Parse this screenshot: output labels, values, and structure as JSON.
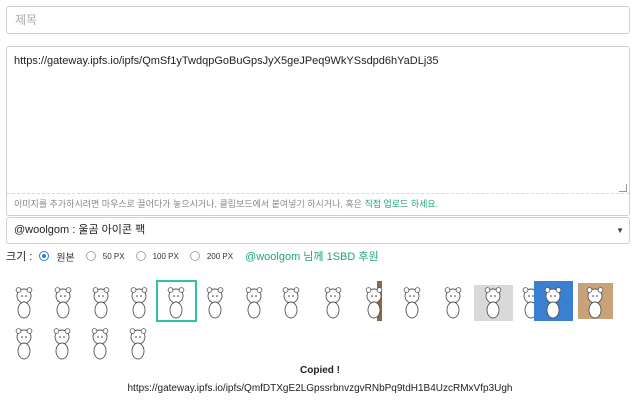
{
  "title_input": {
    "placeholder": "제목"
  },
  "editor": {
    "content": "https://gateway.ipfs.io/ipfs/QmSf1yTwdqpGoBuGpsJyX5geJPeq9WkYSsdpd6hYaDLj35",
    "hint_prefix": "이미지를 추가하시려면 마우스로 끌어다가 놓으시거나, 클립보드에서 붙여넣기 하시거나, 혹은 ",
    "hint_link": "직접 업로드 하세요."
  },
  "pack_select": {
    "selected": "@woolgom : 울곰 아이콘 팩"
  },
  "size": {
    "label": "크기 :",
    "options": [
      {
        "label": "원본",
        "checked": true
      },
      {
        "label": "50 PX",
        "checked": false
      },
      {
        "label": "100 PX",
        "checked": false
      },
      {
        "label": "200 PX",
        "checked": false
      }
    ],
    "support_link": "@woolgom 님께 1SBD 후원"
  },
  "icons": {
    "count": 20,
    "selected_index": 4,
    "names": [
      "bear-trash-icon",
      "bear-cat-icon",
      "bear-pair-icon",
      "bear-umbrella-icon",
      "bear-cheer-icon",
      "bear-bath-icon",
      "bear-stand-icon",
      "bear-lying-icon",
      "bear-computer-icon",
      "bear-peek-icon",
      "bear-rain-icon",
      "bear-sit-icon",
      "bear-wall-icon",
      "bear-shrug-icon",
      "bear-jump-icon",
      "bear-corner-icon",
      "bear-sad-icon",
      "bear-wave-icon",
      "bear-rabbit-icon",
      "bear-flower-icon"
    ]
  },
  "status": {
    "copied": "Copied !",
    "url": "https://gateway.ipfs.io/ipfs/QmfDTXgE2LGpssrbnvzgvRNbPq9tdH1B4UzcRMxVfp3Ugh"
  },
  "colors": {
    "accent": "#1aa67a",
    "selected_border": "#2ec4a3",
    "radio": "#2b7de9"
  }
}
